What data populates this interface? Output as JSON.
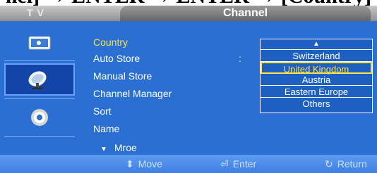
{
  "caption_fragment": "nel] → ENTER → ENTER → [Country]",
  "header": {
    "tv_label": "T V",
    "title": "Channel"
  },
  "sidebar": {
    "items": [
      {
        "icon": "picture-icon"
      },
      {
        "icon": "satellite-dish-icon",
        "active": true
      },
      {
        "icon": "setup-gear-icon"
      }
    ]
  },
  "menu": {
    "items": [
      "Country",
      "Auto Store",
      "Manual Store",
      "Channel Manager",
      "Sort",
      "Name"
    ],
    "more": "Mroe",
    "more_arrow": "▼",
    "colon": ":"
  },
  "dropdown": {
    "up_arrow": "▲",
    "options": [
      "Switzerland",
      "United Kingdom",
      "Austria",
      "Eastern Europe",
      "Others"
    ],
    "selected": "United Kingdom"
  },
  "footer": {
    "move": "Move",
    "enter": "Enter",
    "return": "Return",
    "move_icon": "⬍",
    "enter_icon": "⏎",
    "return_icon": "↻"
  },
  "colors": {
    "highlight": "#ffe24a",
    "panel": "#2a6fd1"
  }
}
